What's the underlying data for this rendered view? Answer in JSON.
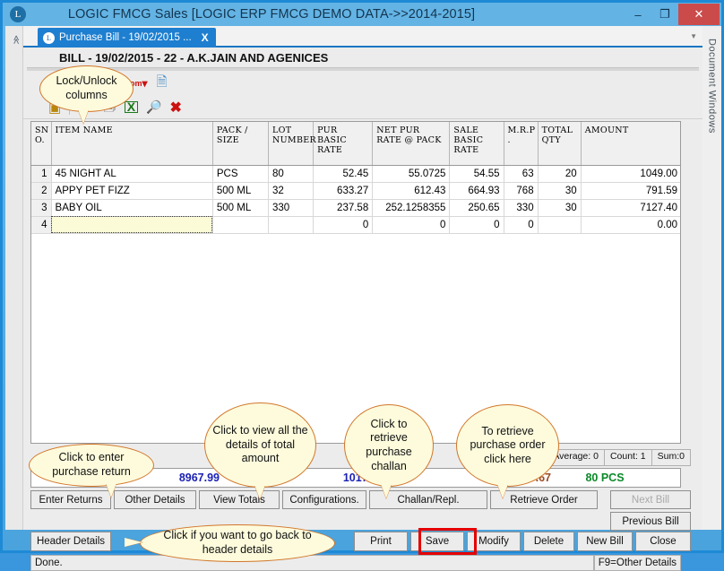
{
  "window": {
    "title": "LOGIC FMCG Sales  [LOGIC ERP FMCG DEMO DATA->>2014-2015]",
    "logo_glyph": "L",
    "minimize": "–",
    "maximize": "❐",
    "close": "✕"
  },
  "docpanel": {
    "label": "Document Windows"
  },
  "tab": {
    "label": "Purchase Bill - 19/02/2015 ...",
    "close": "X",
    "icon_glyph": "L",
    "dropdown": "▼"
  },
  "doc_header": {
    "text": "BILL - 19/02/2015 - 22 - A.K.JAIN AND AGENICES"
  },
  "toolbar1": {
    "items": [
      {
        "name": "grid-icon",
        "glyph": "▦"
      },
      {
        "name": "delete-icon",
        "glyph": "✕"
      },
      {
        "name": "print-icon",
        "glyph": "🖶"
      },
      {
        "name": "zoom-icon",
        "glyph": "Zom"
      },
      {
        "name": "document-icon",
        "glyph": "🗋"
      }
    ]
  },
  "toolbar2": {
    "items": [
      {
        "name": "lock-columns-icon",
        "glyph": "▤"
      },
      {
        "name": "resize-columns-icon",
        "glyph": "↔"
      },
      {
        "name": "copy-icon",
        "glyph": "🗐"
      },
      {
        "name": "export-excel-icon",
        "glyph": "X"
      },
      {
        "name": "find-icon",
        "glyph": "🔍"
      },
      {
        "name": "clear-icon",
        "glyph": "✕"
      }
    ]
  },
  "grid": {
    "columns": [
      "SN O.",
      "ITEM NAME",
      "PACK / SIZE",
      "LOT NUMBER",
      "PUR BASIC RATE",
      "NET PUR RATE @ PACK",
      "SALE BASIC RATE",
      "M.R.P .",
      "TOTAL QTY",
      "AMOUNT"
    ],
    "rows": [
      {
        "sno": "1",
        "item_name": "45 NIGHT AL",
        "pack_size": "PCS",
        "lot_number": "80",
        "pur_basic_rate": "52.45",
        "net_pur_rate_at_pack": "55.0725",
        "sale_basic_rate": "54.55",
        "mrp": "63",
        "total_qty": "20",
        "amount": "1049.00"
      },
      {
        "sno": "2",
        "item_name": "APPY PET FIZZ",
        "pack_size": "500 ML",
        "lot_number": "32",
        "pur_basic_rate": "633.27",
        "net_pur_rate_at_pack": "612.43",
        "sale_basic_rate": "664.93",
        "mrp": "768",
        "total_qty": "30",
        "amount": "791.59"
      },
      {
        "sno": "3",
        "item_name": "BABY OIL",
        "pack_size": "500 ML",
        "lot_number": "330",
        "pur_basic_rate": "237.58",
        "net_pur_rate_at_pack": "252.1258355",
        "sale_basic_rate": "250.65",
        "mrp": "330",
        "total_qty": "30",
        "amount": "7127.40"
      },
      {
        "sno": "4",
        "item_name": "",
        "pack_size": "",
        "lot_number": "",
        "pur_basic_rate": "0",
        "net_pur_rate_at_pack": "0",
        "sale_basic_rate": "0",
        "mrp": "0",
        "total_qty": "",
        "amount": "0.00"
      }
    ]
  },
  "stats": {
    "average": "Average: 0",
    "count": "Count: 1",
    "sum": "Sum:0"
  },
  "totals": {
    "value_1": "8967.99",
    "value_2": "10178.67",
    "value_3": "10178.67",
    "value_4": "80 PCS",
    "color_1": "#1b21b5",
    "color_2": "#1b21b5",
    "color_3": "#9c4a20",
    "color_4": "#0a8a28"
  },
  "action_buttons": {
    "enter_returns": "Enter Returns",
    "other_details": "Other Details",
    "view_totals": "View Totals",
    "configurations": "Configurations.",
    "challan_repl": "Challan/Repl.",
    "retrieve_order": "Retrieve Order",
    "next_bill": "Next Bill",
    "previous_bill": "Previous Bill",
    "header_details": "Header Details",
    "print": "Print",
    "save": "Save",
    "modify": "Modify",
    "delete": "Delete",
    "new_bill": "New Bill",
    "close": "Close"
  },
  "statusbar": {
    "message": "Done.",
    "hint": "F9=Other Details"
  },
  "callouts": {
    "lock_unlock": "Lock/Unlock columns",
    "enter_return": "Click to enter purchase return",
    "view_totals": "Click to view all the details of total amount",
    "challan": "Click to retrieve purchase challan",
    "retrieve_order": "To retrieve purchase order click here",
    "header_details": "Click if you want to go back to header details"
  },
  "highlight": {
    "target": "Save",
    "color": "#e50000"
  }
}
